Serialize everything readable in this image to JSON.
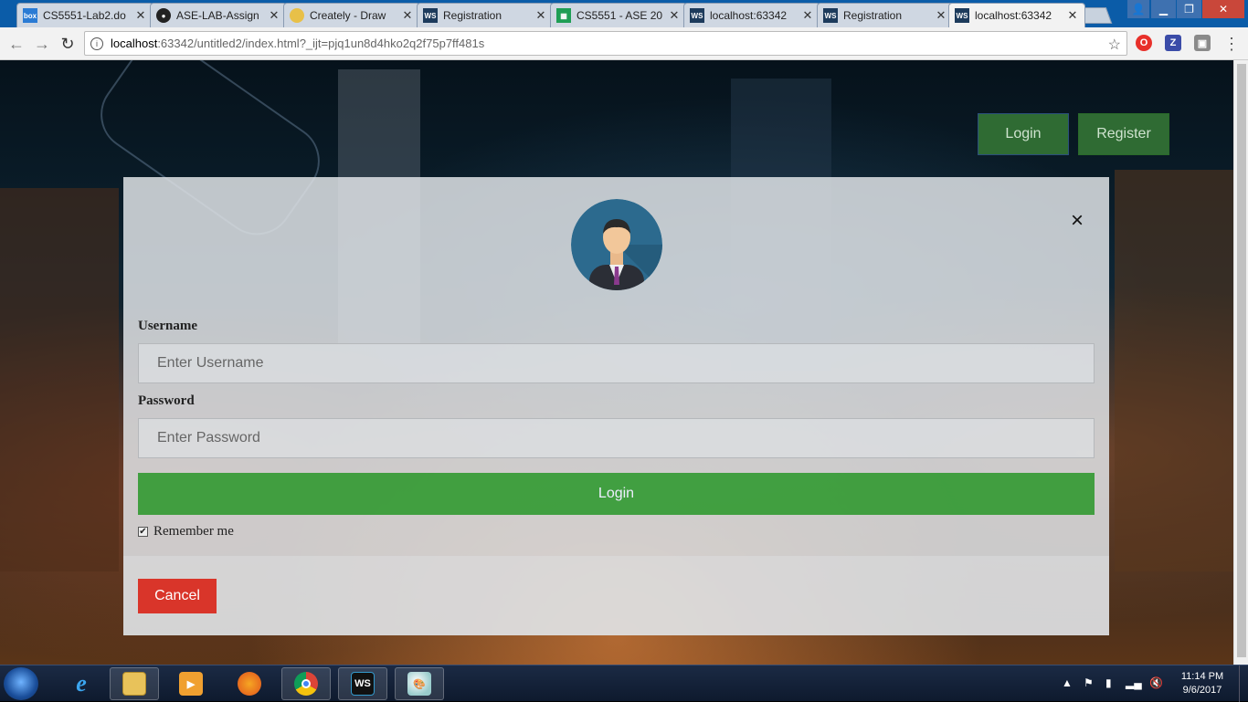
{
  "browser": {
    "tabs": [
      {
        "title": "CS5551-Lab2.do",
        "icon": "box-icon",
        "color": "#2a7bd4"
      },
      {
        "title": "ASE-LAB-Assign",
        "icon": "github-icon",
        "color": "#222222"
      },
      {
        "title": "Creately - Draw",
        "icon": "bulb-icon",
        "color": "#e8c048"
      },
      {
        "title": "Registration",
        "icon": "webstorm-icon",
        "color": "#1d3b5c"
      },
      {
        "title": "CS5551 - ASE 20",
        "icon": "sheets-icon",
        "color": "#1e9e54"
      },
      {
        "title": "localhost:63342",
        "icon": "webstorm-icon",
        "color": "#1d3b5c"
      },
      {
        "title": "Registration",
        "icon": "webstorm-icon",
        "color": "#1d3b5c"
      },
      {
        "title": "localhost:63342",
        "icon": "webstorm-icon",
        "color": "#1d3b5c"
      }
    ],
    "active_tab_index": 7,
    "url_host": "localhost",
    "url_rest": ":63342/untitled2/index.html?_ijt=pjq1un8d4hko2q2f75p7ff481s"
  },
  "page": {
    "top_login_label": "Login",
    "top_register_label": "Register",
    "modal": {
      "username_label": "Username",
      "username_placeholder": "Enter Username",
      "password_label": "Password",
      "password_placeholder": "Enter Password",
      "login_button": "Login",
      "remember_label": "Remember me",
      "remember_checked": true,
      "cancel_button": "Cancel",
      "close_glyph": "×"
    }
  },
  "taskbar": {
    "time": "11:14 PM",
    "date": "9/6/2017",
    "apps": [
      "internet-explorer",
      "file-explorer",
      "media-player",
      "firefox",
      "chrome",
      "webstorm",
      "paint"
    ]
  }
}
